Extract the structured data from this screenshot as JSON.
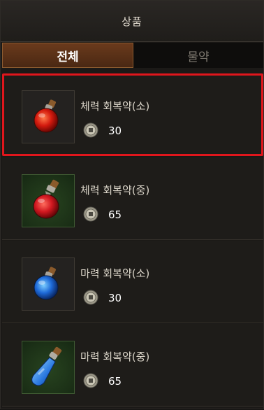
{
  "header": {
    "title": "상품"
  },
  "tabs": [
    {
      "label": "전체",
      "active": true
    },
    {
      "label": "물약",
      "active": false
    }
  ],
  "items": [
    {
      "name": "체력 회복약(소)",
      "price": "30",
      "potion": "red",
      "icon": "red-potion-small-icon",
      "selected": true
    },
    {
      "name": "체력 회복약(중)",
      "price": "65",
      "potion": "red",
      "icon": "red-potion-medium-icon",
      "selected": false
    },
    {
      "name": "마력 회복약(소)",
      "price": "30",
      "potion": "blue",
      "icon": "blue-potion-small-icon",
      "selected": false
    },
    {
      "name": "마력 회복약(중)",
      "price": "65",
      "potion": "blue",
      "icon": "blue-potion-medium-icon",
      "selected": false
    }
  ],
  "currency_icon": "coin-icon",
  "colors": {
    "selection_border": "#e0161c",
    "tab_active": "#6a3a1c"
  }
}
